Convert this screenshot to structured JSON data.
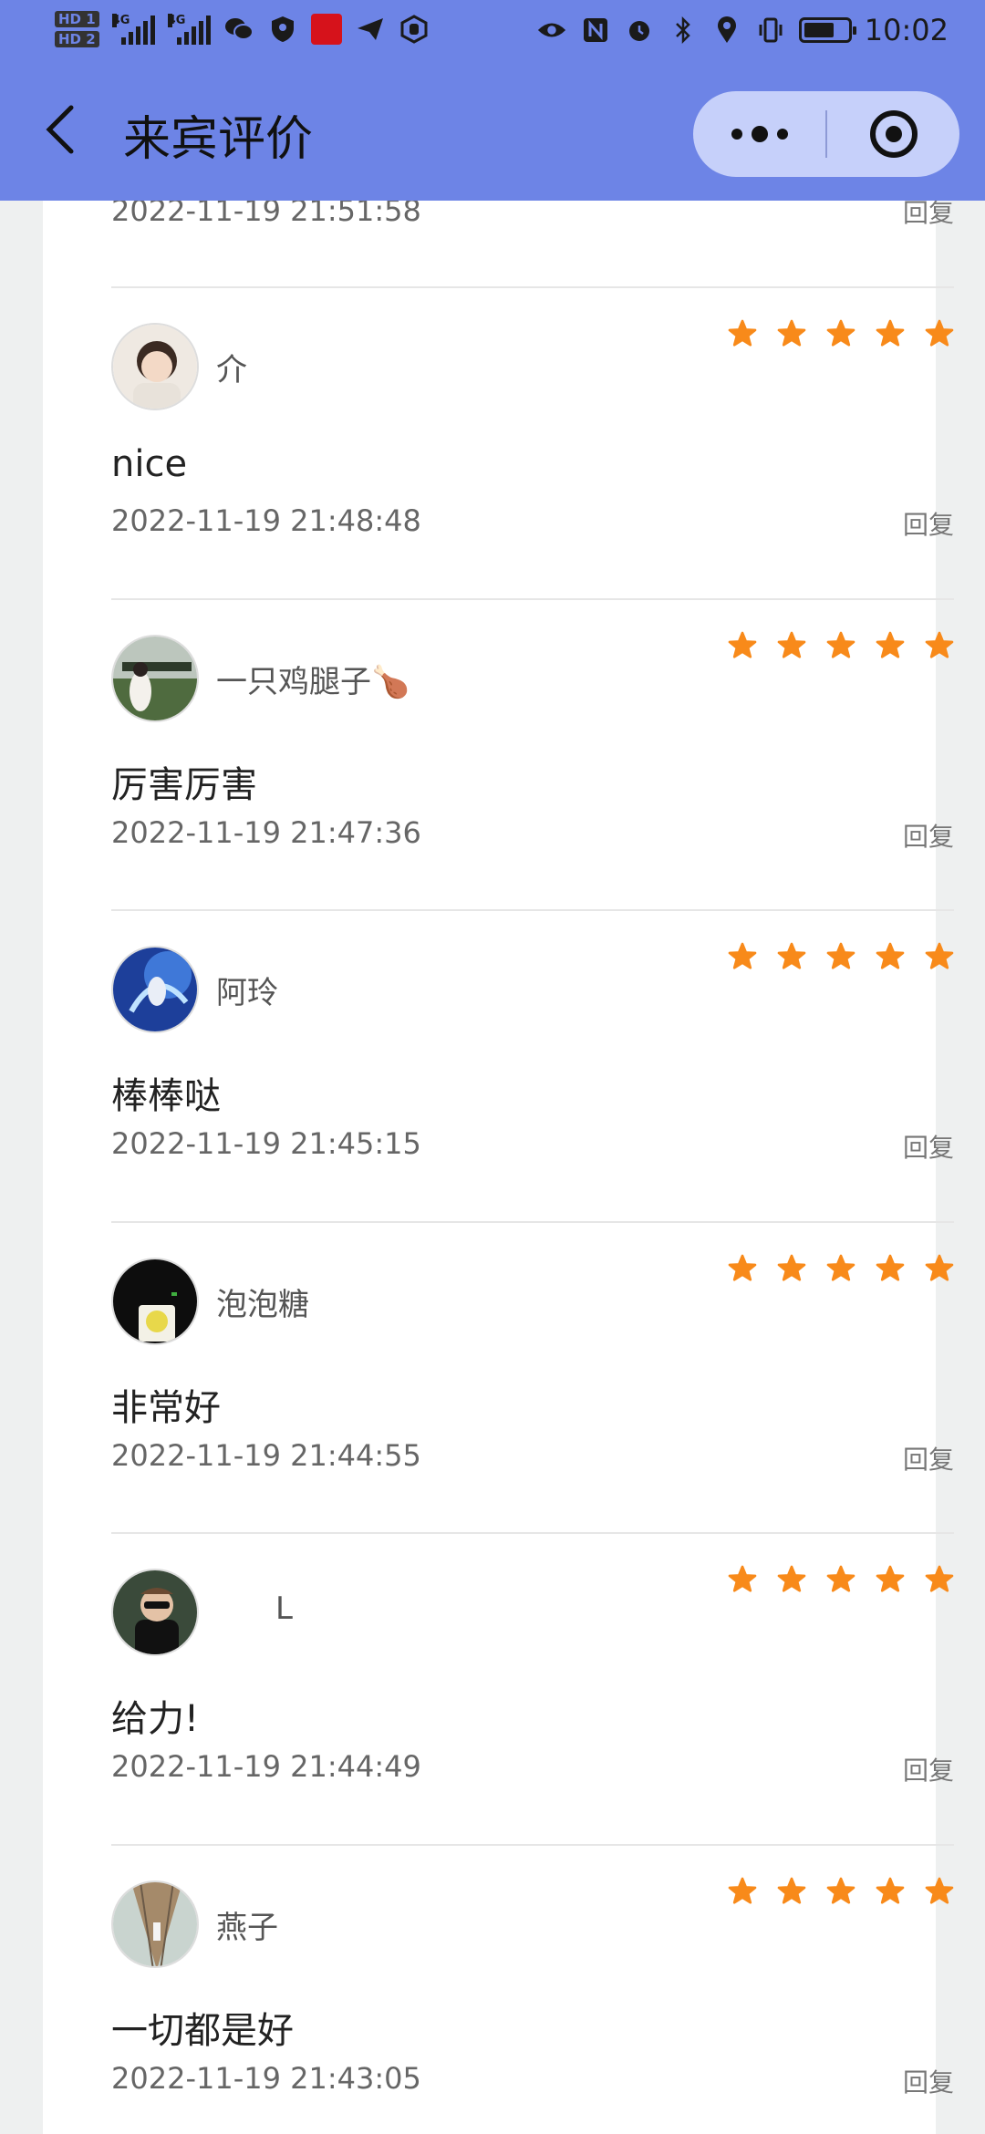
{
  "status_bar": {
    "time": "10:02",
    "hd1": "HD 1",
    "hd2": "HD 2",
    "net1": "4G",
    "net2": "4G"
  },
  "nav": {
    "title": "来宾评价"
  },
  "colors": {
    "header_bg": "#6d84e6",
    "star": "#f88a1a",
    "capsule_bg": "#c6d0fa"
  },
  "top_partial": {
    "time": "2022-11-19 21:51:58",
    "reply": "回复"
  },
  "reviews": [
    {
      "nickname": "介",
      "content": "nice",
      "time": "2022-11-19 21:48:48",
      "reply": "回复",
      "rating": 5
    },
    {
      "nickname": "一只鸡腿子🍗",
      "content": "厉害厉害",
      "time": "2022-11-19 21:47:36",
      "reply": "回复",
      "rating": 5
    },
    {
      "nickname": "阿玲",
      "content": "棒棒哒",
      "time": "2022-11-19 21:45:15",
      "reply": "回复",
      "rating": 5
    },
    {
      "nickname": "泡泡糖",
      "content": "非常好",
      "time": "2022-11-19 21:44:55",
      "reply": "回复",
      "rating": 5
    },
    {
      "nickname": "L",
      "content": "给力!",
      "time": "2022-11-19 21:44:49",
      "reply": "回复",
      "rating": 5
    },
    {
      "nickname": "燕子",
      "content": "一切都是好",
      "time": "2022-11-19 21:43:05",
      "reply": "回复",
      "rating": 5
    }
  ]
}
